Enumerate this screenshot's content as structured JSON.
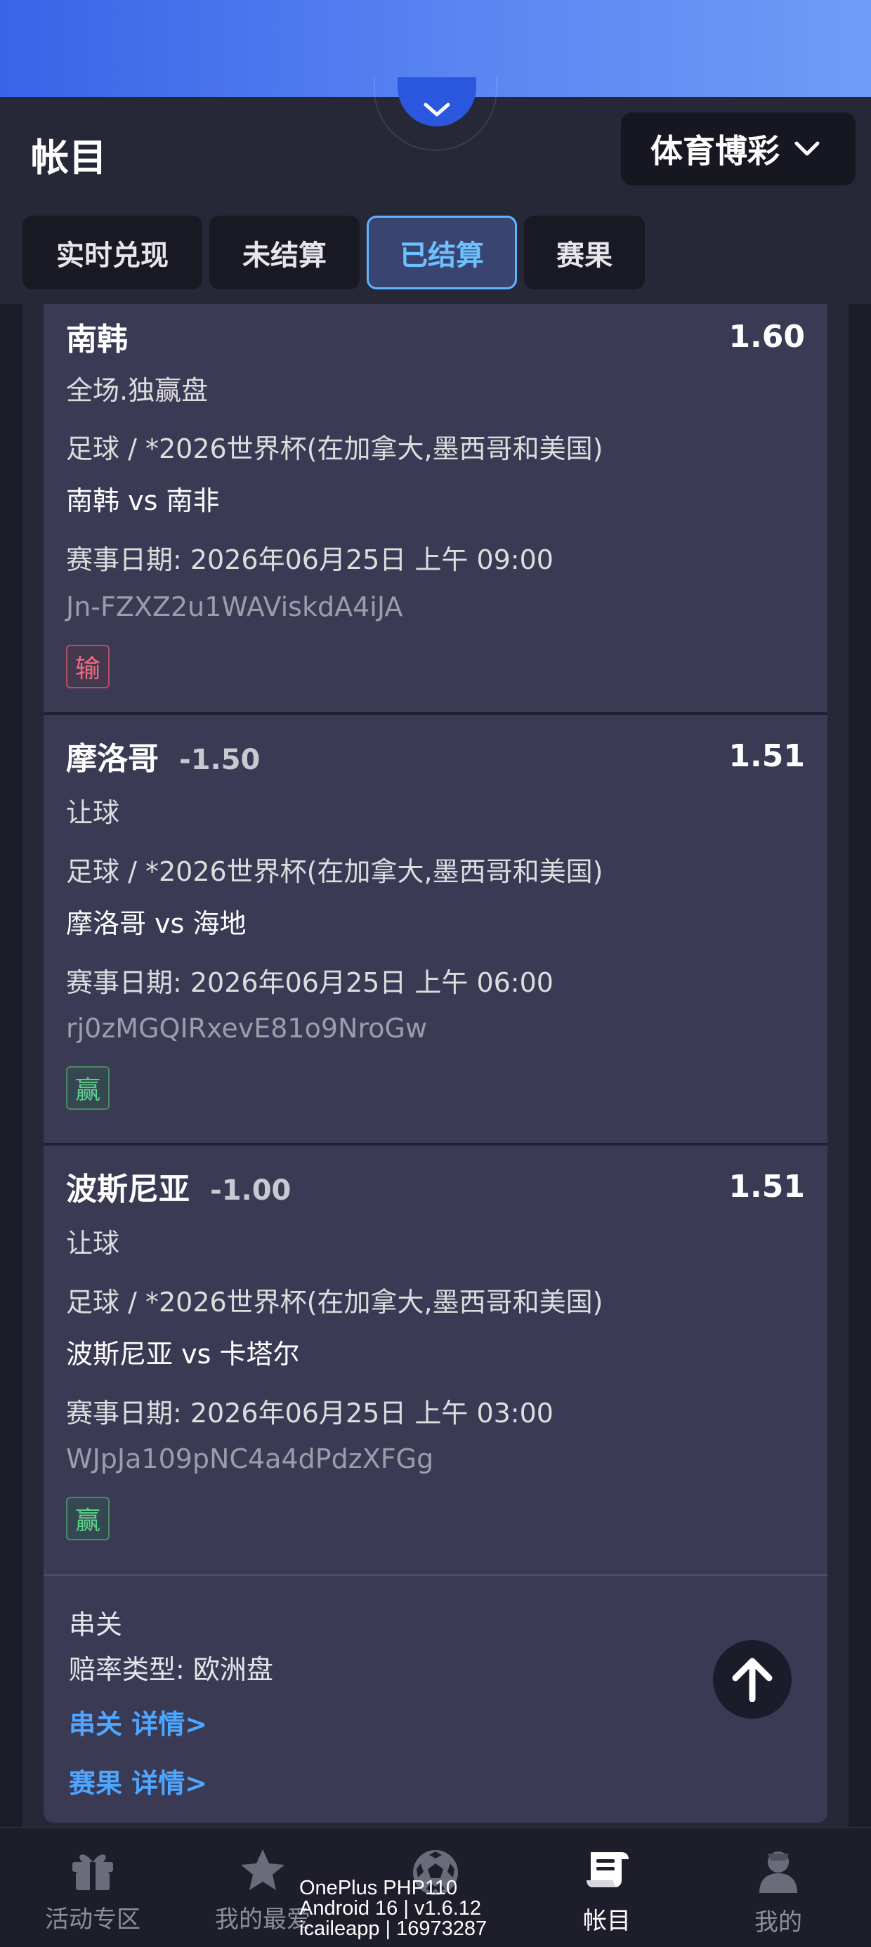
{
  "header": {
    "title": "帐目",
    "market_select": "体育博彩",
    "tabs": [
      "实时兑现",
      "未结算",
      "已结算",
      "赛果"
    ],
    "active_tab": "已结算"
  },
  "bets": [
    {
      "selection": "南韩",
      "handicap": "",
      "odds": "1.60",
      "market": "全场.独赢盘",
      "league": "足球 / *2026世界杯(在加拿大,墨西哥和美国)",
      "match": "南韩 vs 南非",
      "date": "赛事日期: 2026年06月25日 上午 09:00",
      "bet_id": "Jn-FZXZ2u1WAViskdA4iJA",
      "result": "输"
    },
    {
      "selection": "摩洛哥",
      "handicap": "-1.50",
      "odds": "1.51",
      "market": "让球",
      "league": "足球 / *2026世界杯(在加拿大,墨西哥和美国)",
      "match": "摩洛哥 vs 海地",
      "date": "赛事日期: 2026年06月25日 上午 06:00",
      "bet_id": "rj0zMGQIRxevE81o9NroGw",
      "result": "赢"
    },
    {
      "selection": "波斯尼亚",
      "handicap": "-1.00",
      "odds": "1.51",
      "market": "让球",
      "league": "足球 / *2026世界杯(在加拿大,墨西哥和美国)",
      "match": "波斯尼亚 vs 卡塔尔",
      "date": "赛事日期: 2026年06月25日 上午 03:00",
      "bet_id": "WJpJa109pNC4a4dPdzXFGg",
      "result": "赢"
    }
  ],
  "summary": {
    "type": "串关",
    "odds_type": "赔率类型: 欧洲盘",
    "parlay_link": "串关 详情>",
    "result_link": "赛果 详情>"
  },
  "bottom_nav": [
    {
      "label": "活动专区",
      "icon": "gift-icon"
    },
    {
      "label": "我的最爱",
      "icon": "star-icon"
    },
    {
      "label": "",
      "icon": "soccer-ball-icon"
    },
    {
      "label": "帐目",
      "icon": "ledger-icon"
    },
    {
      "label": "我的",
      "icon": "user-icon"
    }
  ],
  "device_overlay": {
    "line1": "OnePlus PHP110",
    "line2": "Android 16 | v1.6.12",
    "line3": "icaileapp | 16973287"
  },
  "colors": {
    "banner": "#3a63e8",
    "background": "#262837",
    "card": "#3a3a55",
    "active_tab_border": "#5fb3ff",
    "link": "#4da6ff",
    "lose": "#ef6b7e",
    "win": "#5ed28e"
  }
}
